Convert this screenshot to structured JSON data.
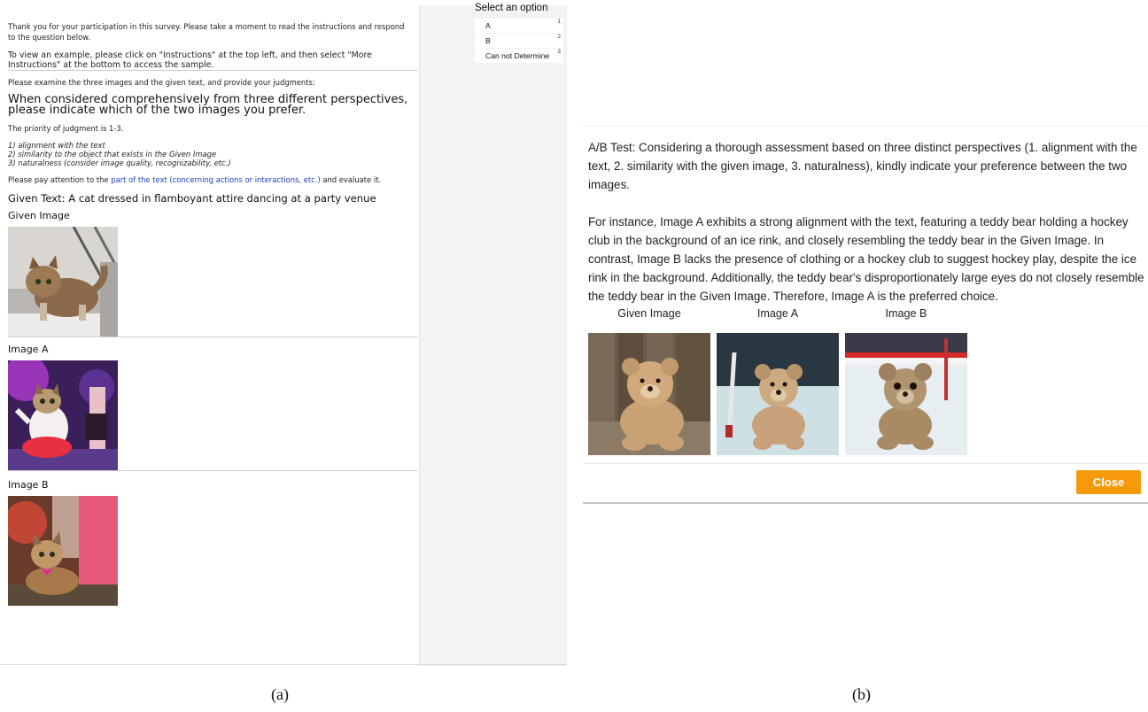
{
  "panel_a": {
    "survey": {
      "intro_thanks": "Thank you for your participation in this survey. Please take a moment to read the instructions and respond to the question below.",
      "intro_example": "To view an example, please click on \"Instructions\" at the top left, and then select \"More Instructions\" at the bottom to access the sample.",
      "examine": "Please examine the three images and the given text, and provide your judgments:",
      "question": "When considered comprehensively from three different perspectives, please indicate which of the two images you prefer.",
      "priority": "The priority of judgment is 1-3.",
      "criteria": [
        "1) alignment with the text",
        "2) similarity to the object that exists in the Given Image",
        "3) naturalness (consider image quality, recognizability, etc.)"
      ],
      "attention_prefix": "Please pay attention to the ",
      "attention_link": "part of the text (concerning actions or interactions, etc.)",
      "attention_suffix": " and evaluate it.",
      "given_text": "Given Text: A cat dressed in flamboyant attire dancing at a party venue",
      "given_image_label": "Given Image",
      "image_a_label": "Image A",
      "image_b_label": "Image B"
    },
    "options": {
      "title": "Select an option",
      "items": [
        {
          "label": "A",
          "key": "1"
        },
        {
          "label": "B",
          "key": "2"
        },
        {
          "label": "Can not Determine",
          "key": "3"
        }
      ]
    },
    "caption": "(a)"
  },
  "panel_b": {
    "paragraph1": "A/B Test: Considering a thorough assessment based on three distinct perspectives (1. alignment with the text, 2. similarity with the given image, 3. naturalness), kindly indicate your preference between the two images.",
    "paragraph2": "For instance, Image A exhibits a strong alignment with the text, featuring a teddy bear holding a hockey club in the background of an ice rink, and closely resembling the teddy bear in the Given Image. In contrast, Image B lacks the presence of clothing or a hockey club to suggest hockey play, despite the ice rink in the background. Additionally, the teddy bear's disproportionately large eyes do not closely resemble the teddy bear in the Given Image. Therefore, Image A is the preferred choice.",
    "given_image_label": "Given Image",
    "image_a_label": "Image A",
    "image_b_label": "Image B",
    "close_label": "Close",
    "caption": "(b)",
    "accent_color": "#f69a0c"
  }
}
